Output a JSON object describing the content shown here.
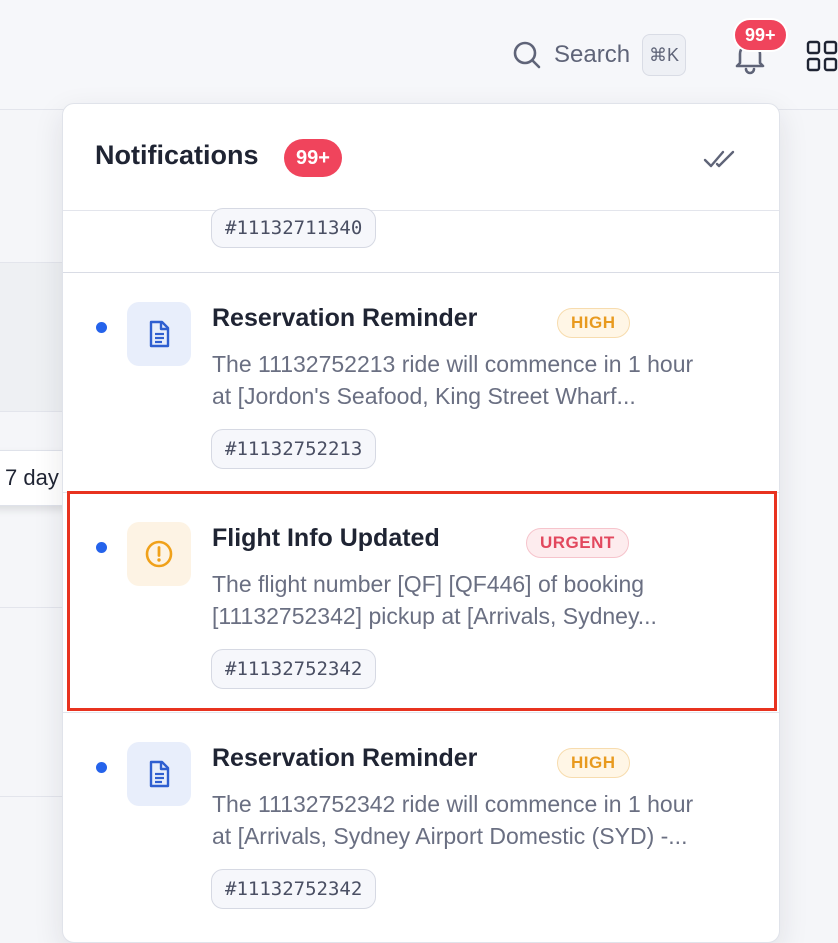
{
  "topbar": {
    "search_label": "Search",
    "search_shortcut": "⌘K",
    "bell_badge": "99+"
  },
  "background": {
    "day_filter_label": "7 day"
  },
  "notifications": {
    "title": "Notifications",
    "count_badge": "99+",
    "partial_item_tag": "#11132711340",
    "items": [
      {
        "icon": "document-icon",
        "title": "Reservation Reminder",
        "priority": "HIGH",
        "body_line1": "The 11132752213 ride will commence in 1 hour",
        "body_line2": "at [Jordon's Seafood, King Street Wharf...",
        "tag": "#11132752213"
      },
      {
        "icon": "alert-circle-icon",
        "title": "Flight Info Updated",
        "priority": "URGENT",
        "body_line1": "The flight number [QF] [QF446] of booking",
        "body_line2": "[11132752342] pickup at [Arrivals, Sydney...",
        "tag": "#11132752342"
      },
      {
        "icon": "document-icon",
        "title": "Reservation Reminder",
        "priority": "HIGH",
        "body_line1": "The 11132752342 ride will commence in 1 hour",
        "body_line2": "at [Arrivals, Sydney Airport Domestic (SYD) -...",
        "tag": "#11132752342"
      }
    ]
  },
  "colors": {
    "unread_dot": "#2563eb",
    "badge_red": "#f0445c",
    "high_priority": "#e89a1f",
    "urgent_priority": "#e2485e",
    "highlight_border": "#e8321f"
  }
}
